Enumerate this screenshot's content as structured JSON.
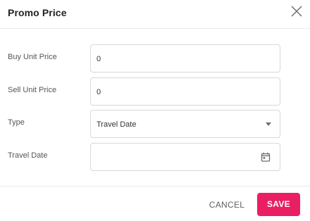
{
  "dialog": {
    "title": "Promo Price",
    "close_icon": "close-icon"
  },
  "form": {
    "buy_unit_price": {
      "label": "Buy Unit Price",
      "value": "0"
    },
    "sell_unit_price": {
      "label": "Sell Unit Price",
      "value": "0"
    },
    "type": {
      "label": "Type",
      "selected": "Travel Date",
      "icon": "dropdown-arrow-icon"
    },
    "travel_date": {
      "label": "Travel Date",
      "value": "",
      "icon": "calendar-icon"
    }
  },
  "footer": {
    "cancel_label": "CANCEL",
    "save_label": "SAVE"
  },
  "colors": {
    "accent": "#e91e63",
    "text": "#222222",
    "border": "#d8d8d8"
  }
}
